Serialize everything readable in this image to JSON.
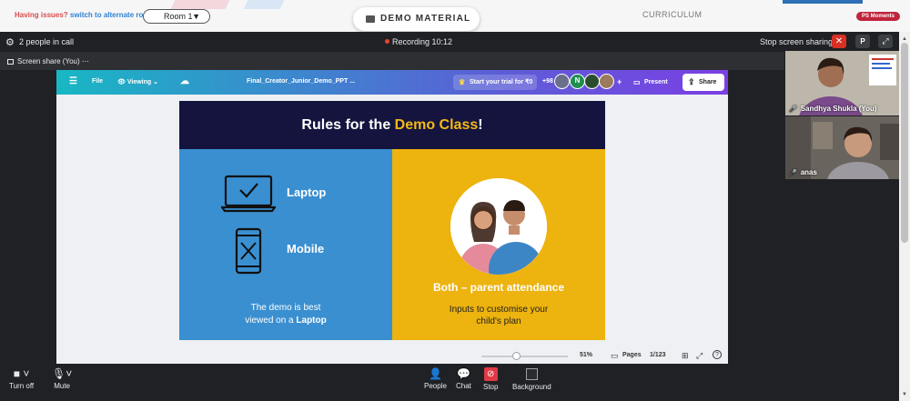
{
  "top": {
    "issues_text": "Having issues?",
    "alt_room_link": "switch to alternate room",
    "room_select": "Room 1",
    "demo_material": "DEMO MATERIAL",
    "curriculum": "CURRICULUM",
    "ps_moments": "PS Moments"
  },
  "call": {
    "people_count": "2 people in call",
    "recording": "Recording 10:12",
    "stop_sharing": "Stop screen sharing",
    "close_symbol": "✕",
    "p_button": "P",
    "share_label": "Screen share (You)",
    "more": "⋯"
  },
  "canva": {
    "file": "File",
    "viewing": "Viewing",
    "doc_name": "Final_Creator_Junior_Demo_PPT ...",
    "trial": "Start your trial for ₹0",
    "avatar_count": "+98",
    "avatar_letter": "N",
    "present": "Present",
    "share": "Share",
    "zoom": "51%",
    "pages": "Pages",
    "page_num": "1/123",
    "zoom_level": 0.4
  },
  "slide": {
    "title_prefix": "Rules for the ",
    "title_highlight": "Demo Class",
    "title_suffix": "!",
    "laptop": "Laptop",
    "mobile": "Mobile",
    "best_line1": "The demo is best",
    "best_line2_prefix": "viewed on a ",
    "best_line2_bold": "Laptop",
    "both_title": "Both – parent attendance",
    "inputs_line1": "Inputs to customise your",
    "inputs_line2": "child's plan"
  },
  "tiles": [
    {
      "name": "Sandhya Shukla (You)"
    },
    {
      "name": "anas"
    }
  ],
  "controls": {
    "turn_off": "Turn off",
    "mute": "Mute",
    "people": "People",
    "chat": "Chat",
    "stop": "Stop",
    "background": "Background"
  },
  "colors": {
    "call_bg": "#202124",
    "stop_red": "#d93025",
    "slide_navy": "#14143f",
    "slide_blue": "#3a8fd0",
    "slide_yellow": "#edb30e",
    "title_highlight": "#f2b915"
  }
}
